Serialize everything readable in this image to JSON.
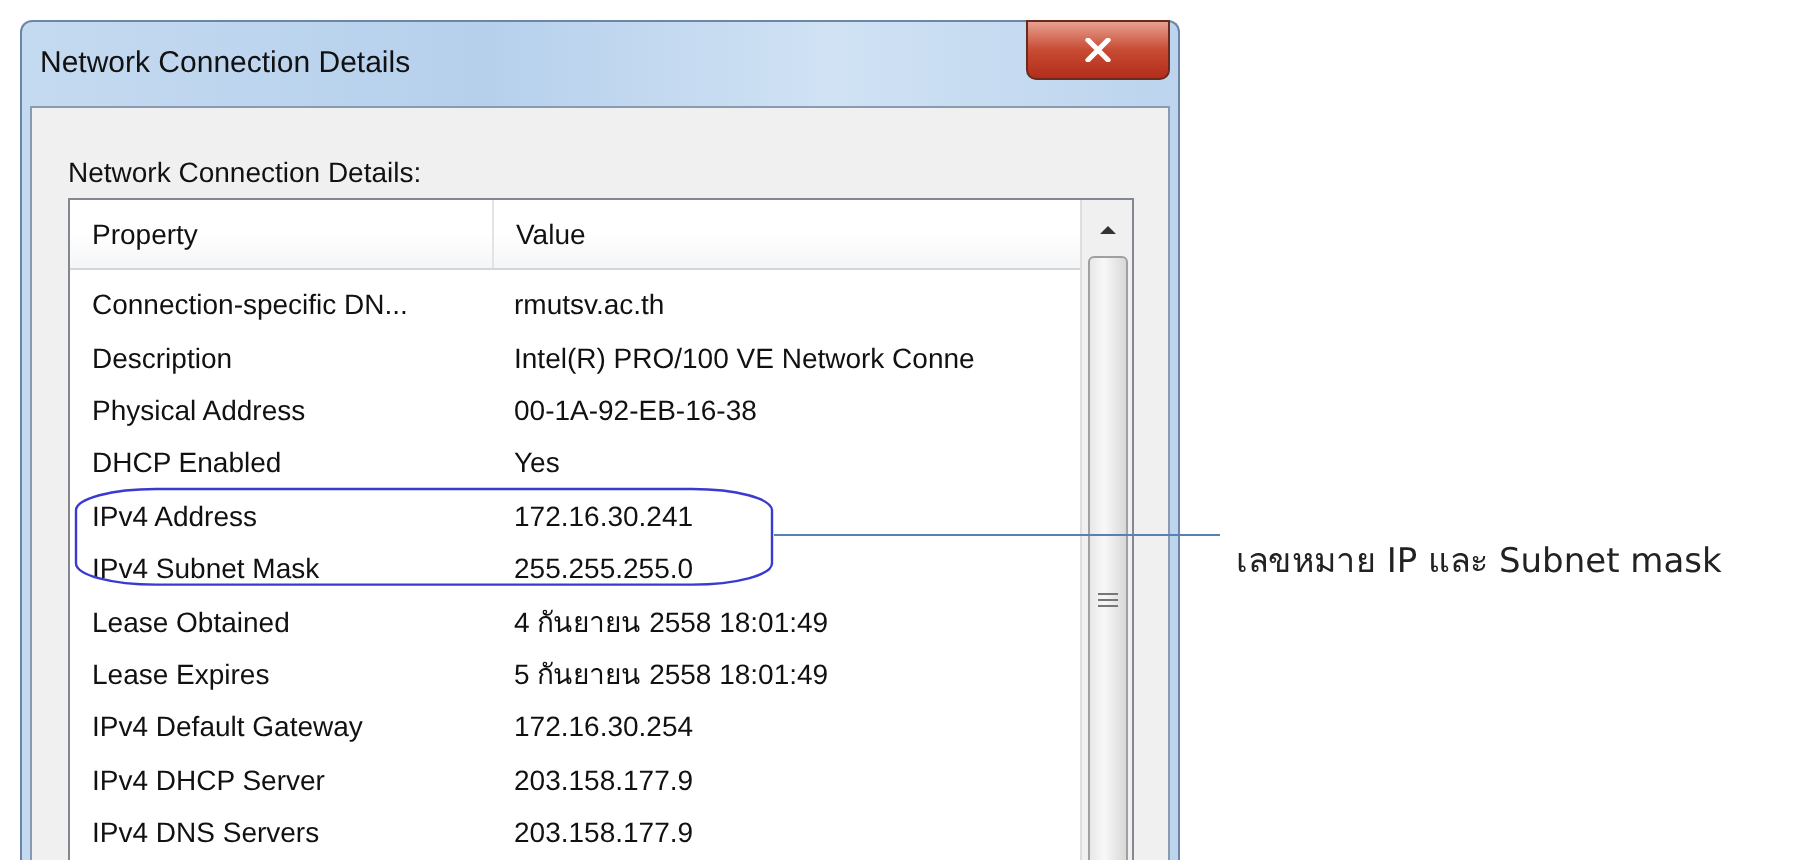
{
  "window": {
    "title": "Network Connection Details"
  },
  "section_label": "Network Connection Details:",
  "table": {
    "columns": [
      "Property",
      "Value"
    ],
    "rows": [
      {
        "property": "Connection-specific DN...",
        "value": "rmutsv.ac.th",
        "highlighted": false
      },
      {
        "property": "Description",
        "value": "Intel(R) PRO/100 VE Network Conne",
        "highlighted": false
      },
      {
        "property": "Physical Address",
        "value": "00-1A-92-EB-16-38",
        "highlighted": false
      },
      {
        "property": "DHCP Enabled",
        "value": "Yes",
        "highlighted": false
      },
      {
        "property": "IPv4 Address",
        "value": "172.16.30.241",
        "highlighted": true
      },
      {
        "property": "IPv4 Subnet Mask",
        "value": "255.255.255.0",
        "highlighted": true
      },
      {
        "property": "Lease Obtained",
        "value": "4 กันยายน 2558 18:01:49",
        "highlighted": false
      },
      {
        "property": "Lease Expires",
        "value": "5 กันยายน 2558 18:01:49",
        "highlighted": false
      },
      {
        "property": "IPv4 Default Gateway",
        "value": "172.16.30.254",
        "highlighted": false
      },
      {
        "property": "IPv4 DHCP Server",
        "value": "203.158.177.9",
        "highlighted": false
      },
      {
        "property": "IPv4 DNS Servers",
        "value": "203.158.177.9",
        "highlighted": false
      }
    ]
  },
  "annotation": "เลขหมาย IP และ Subnet mask"
}
